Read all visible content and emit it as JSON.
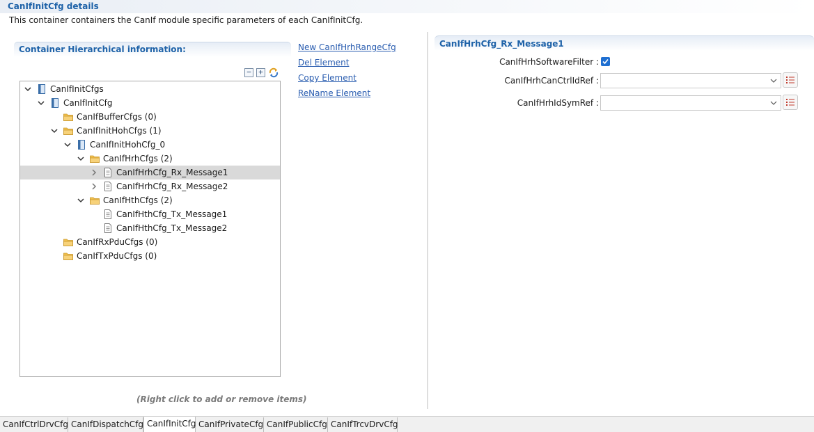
{
  "header": {
    "title": "CanIfInitCfg details",
    "description": "This container containers the CanIf module specific parameters of each CanIfInitCfg."
  },
  "hierarchy": {
    "title": "Container Hierarchical information:",
    "hint": "(Right click to add or remove items)",
    "tools": {
      "collapse_all": "−",
      "expand_all": "+"
    },
    "nodes": [
      {
        "label": "CanIfInitCfgs",
        "icon": "module-icon",
        "arrow": "expanded"
      },
      {
        "label": "CanIfInitCfg",
        "icon": "module-icon",
        "arrow": "expanded"
      },
      {
        "label": "CanIfBufferCfgs (0)",
        "icon": "folder-icon",
        "arrow": "none"
      },
      {
        "label": "CanIfInitHohCfgs (1)",
        "icon": "folder-icon",
        "arrow": "expanded"
      },
      {
        "label": "CanIfInitHohCfg_0",
        "icon": "module-icon",
        "arrow": "expanded"
      },
      {
        "label": "CanIfHrhCfgs (2)",
        "icon": "folder-icon",
        "arrow": "expanded"
      },
      {
        "label": "CanIfHrhCfg_Rx_Message1",
        "icon": "document-icon",
        "arrow": "collapsed",
        "selected": true
      },
      {
        "label": "CanIfHrhCfg_Rx_Message2",
        "icon": "document-icon",
        "arrow": "collapsed"
      },
      {
        "label": "CanIfHthCfgs (2)",
        "icon": "folder-icon",
        "arrow": "expanded"
      },
      {
        "label": "CanIfHthCfg_Tx_Message1",
        "icon": "document-icon",
        "arrow": "none"
      },
      {
        "label": "CanIfHthCfg_Tx_Message2",
        "icon": "document-icon",
        "arrow": "none"
      },
      {
        "label": "CanIfRxPduCfgs (0)",
        "icon": "folder-icon",
        "arrow": "none"
      },
      {
        "label": "CanIfTxPduCfgs (0)",
        "icon": "folder-icon",
        "arrow": "none"
      }
    ]
  },
  "actions": [
    "New CanIfHrhRangeCfg",
    "Del Element",
    "Copy Element",
    "ReName Element"
  ],
  "details": {
    "title": "CanIfHrhCfg_Rx_Message1",
    "software_filter": {
      "label": "CanIfHrhSoftwareFilter :",
      "checked": true
    },
    "can_ctrl_id_ref": {
      "label": "CanIfHrhCanCtrlIdRef :",
      "value": ""
    },
    "id_sym_ref": {
      "label": "CanIfHrhIdSymRef :",
      "value": ""
    }
  },
  "tabs": [
    {
      "label": "CanIfCtrlDrvCfg",
      "active": false
    },
    {
      "label": "CanIfDispatchCfg",
      "active": false
    },
    {
      "label": "CanIfInitCfg",
      "active": true
    },
    {
      "label": "CanIfPrivateCfg",
      "active": false
    },
    {
      "label": "CanIfPublicCfg",
      "active": false
    },
    {
      "label": "CanIfTrcvDrvCfg",
      "active": false
    }
  ],
  "colors": {
    "accent": "#1e62a8",
    "link": "#2a5db0",
    "selection": "#d9d9d9",
    "checkbox": "#1f6fd1",
    "folder": "#f2c14e"
  }
}
